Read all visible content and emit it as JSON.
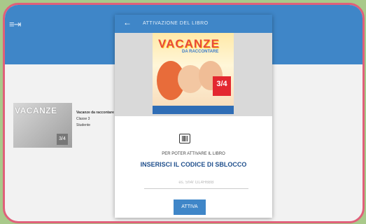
{
  "modal": {
    "title": "ATTIVAZIONE DEL LIBRO",
    "cover_title": "VACANZE",
    "cover_subtitle": "DA RACCONTARE",
    "cover_grade": "3/4",
    "prompt_small": "PER POTER ATTIVARE IL LIBRO",
    "prompt_big": "INSERISCI IL CODICE DI SBLOCCO",
    "code_placeholder": "es. 5h4r GL4H6BB",
    "activate_label": "ATTIVA"
  },
  "book_card": {
    "cover_title": "VACANZE",
    "cover_grade": "3/4",
    "title": "Vacanze da raccontare",
    "class": "Classe 3",
    "role": "Studente"
  },
  "colors": {
    "primary": "#3f86c8",
    "frame": "#e0607a",
    "accent": "#e84a3a"
  }
}
